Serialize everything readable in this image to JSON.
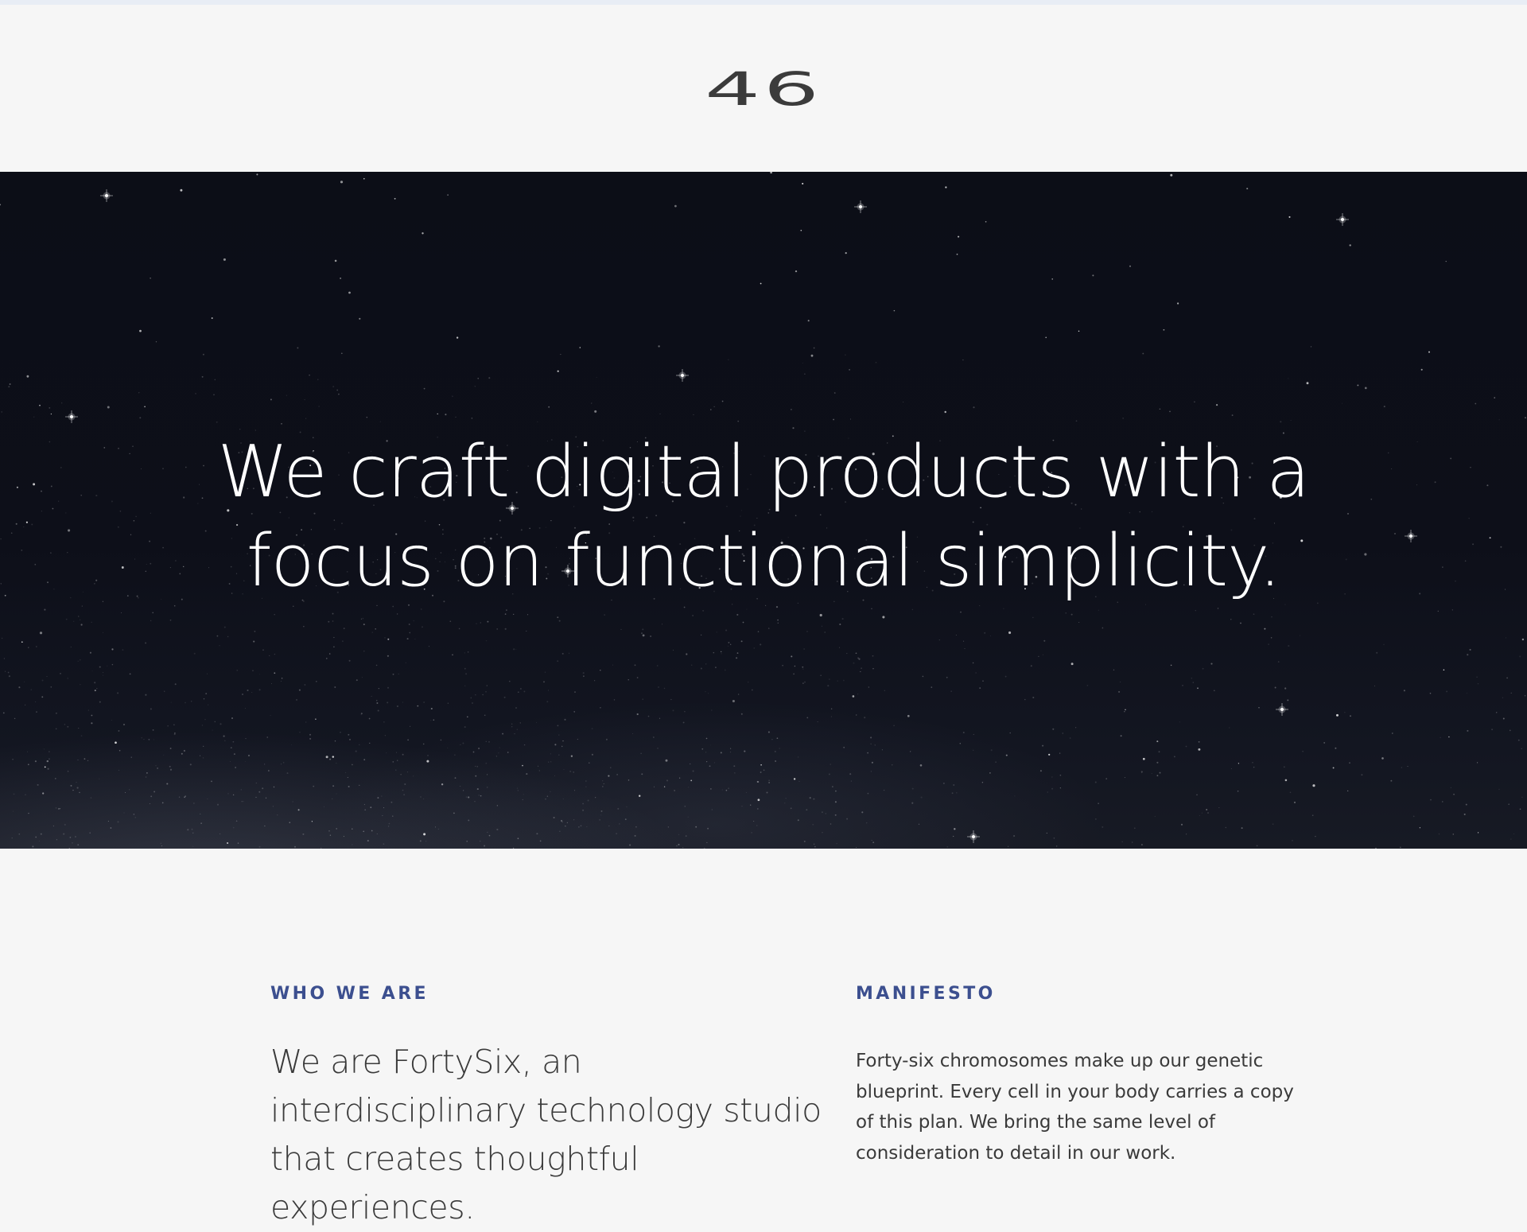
{
  "header": {
    "logo_text": "46"
  },
  "hero": {
    "headline_line1": "We craft digital products with a",
    "headline_line2": "focus on functional simplicity."
  },
  "sections": {
    "who_we_are": {
      "label": "WHO WE ARE",
      "text": "We are FortySix, an interdisciplinary technology studio that creates thoughtful experiences."
    },
    "manifesto": {
      "label": "MANIFESTO",
      "text": "Forty-six chromosomes make up our genetic blueprint. Every cell in your body carries a copy of this plan. We bring the same level of consideration to detail in our work."
    }
  },
  "colors": {
    "accent": "#3c4f8f",
    "hero_bg": "#0c0e17",
    "page_bg": "#f6f6f6",
    "text": "#3a3a3a"
  }
}
